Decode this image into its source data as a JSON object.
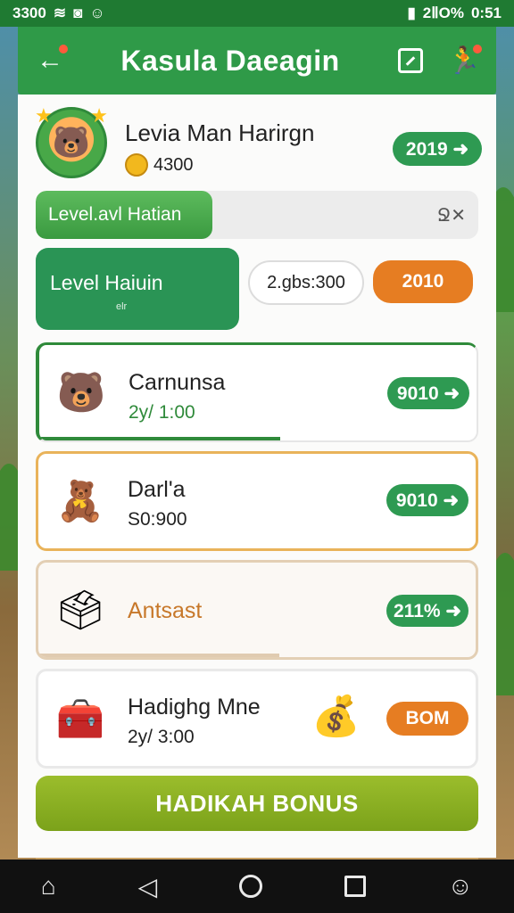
{
  "status": {
    "left_text": "3300",
    "battery": "2ⅡO%",
    "time": "0:51"
  },
  "header": {
    "title": "Kasula Daeagin",
    "back_icon": "back-arrow-icon",
    "edit_icon": "edit-square-icon",
    "profile_icon": "person-icon"
  },
  "profile": {
    "name": "Levia Man Harirgn",
    "coins": "4300",
    "button": "2019 ➜"
  },
  "progress": {
    "label": "Level.avl Hatian",
    "right_text": "Ջ✕",
    "fill_fraction": 0.4
  },
  "level": {
    "title": "Level Haiuin",
    "sub": "elr",
    "chip": "2.gbs:300",
    "orange_button": "2010"
  },
  "cards": [
    {
      "title": "Carnunsa",
      "sub": "2y/ 1:00",
      "button": "9010 ➜",
      "icon": "bear-icon"
    },
    {
      "title": "Darl'a",
      "sub": "S0:900",
      "button": "9010 ➜",
      "icon": "red-bear-icon"
    },
    {
      "title": "Antsast",
      "sub": "",
      "button": "211% ➜",
      "icon": "gift-box-icon"
    },
    {
      "title": "Hadighg Mne",
      "sub": "2y/ 3:00",
      "button": "BOM",
      "icon": "treasure-chest-icon"
    }
  ],
  "bonus_button": "HADIKAH BONUS",
  "colors": {
    "primary_green": "#2f9a48",
    "orange": "#e67d22",
    "bonus_lime": "#8bb022"
  }
}
